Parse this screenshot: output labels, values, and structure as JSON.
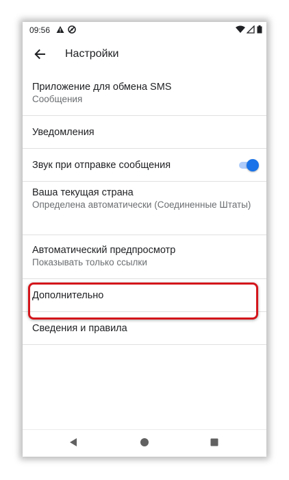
{
  "status_bar": {
    "time": "09:56",
    "icons_left": [
      "warning-icon",
      "do-not-disturb-icon"
    ],
    "icons_right": [
      "wifi-icon",
      "signal-icon",
      "battery-icon"
    ]
  },
  "app_bar": {
    "back_icon": "arrow-back-icon",
    "title": "Настройки"
  },
  "settings": {
    "items": [
      {
        "primary": "Приложение для обмена SMS",
        "secondary": "Сообщения"
      },
      {
        "primary": "Уведомления"
      },
      {
        "primary": "Звук при отправке сообщения",
        "toggle_on": true
      },
      {
        "primary": "Ваша текущая страна",
        "secondary": "Определена автоматически (Соединенные Штаты)"
      },
      {
        "primary": "Автоматический предпросмотр",
        "secondary": "Показывать только ссылки"
      },
      {
        "primary": "Дополнительно",
        "highlighted": true
      },
      {
        "primary": "Сведения и правила"
      }
    ]
  },
  "nav_bar": {
    "icons": [
      "back-triangle-icon",
      "home-circle-icon",
      "recents-square-icon"
    ]
  },
  "colors": {
    "accent": "#1a73e8",
    "toggle_track": "#aecbfa",
    "highlight": "#d3151b",
    "divider": "#e0e0e0"
  }
}
